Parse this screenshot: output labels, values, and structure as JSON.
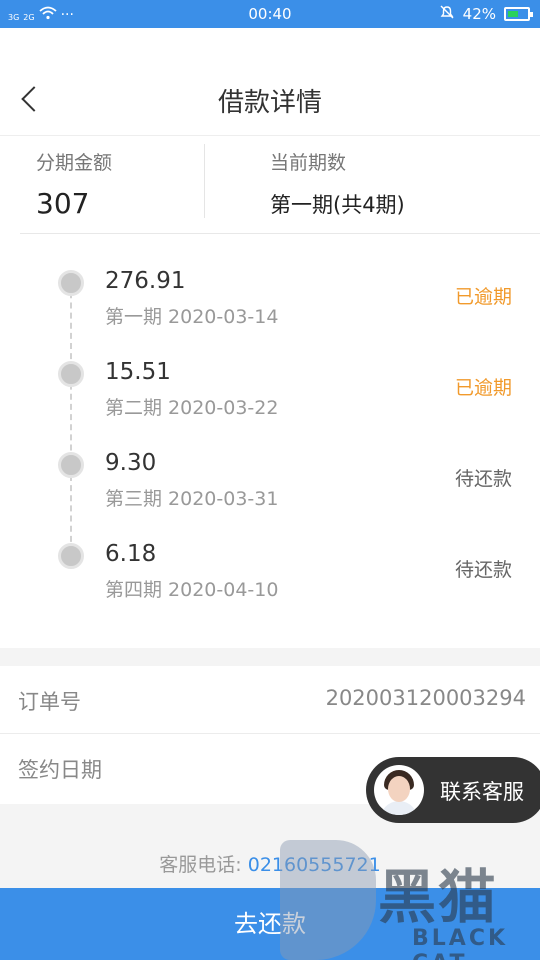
{
  "status_bar": {
    "network_1": "3G",
    "network_2": "2G",
    "more": "···",
    "time": "00:40",
    "battery": "42%"
  },
  "header": {
    "title": "借款详情"
  },
  "summary": {
    "amount_label": "分期金额",
    "amount_value": "307",
    "period_label": "当前期数",
    "period_value": "第一期(共4期)"
  },
  "installments": [
    {
      "amount": "276.91",
      "date": "第一期 2020-03-14",
      "status": "已逾期"
    },
    {
      "amount": "15.51",
      "date": "第二期 2020-03-22",
      "status": "已逾期"
    },
    {
      "amount": "9.30",
      "date": "第三期 2020-03-31",
      "status": "待还款"
    },
    {
      "amount": "6.18",
      "date": "第四期 2020-04-10",
      "status": "待还款"
    }
  ],
  "order": {
    "order_label": "订单号",
    "order_value": "202003120003294",
    "sign_label": "签约日期"
  },
  "service": {
    "phone_label": "客服电话:",
    "phone_number": "02160555721",
    "contact_label": "联系客服"
  },
  "cta": {
    "label": "去还款"
  },
  "watermark": {
    "cn": "黑猫",
    "en": "BLACK CAT"
  },
  "colors": {
    "primary": "#3b8fe8",
    "overdue": "#f19a2c",
    "pending": "#666666"
  }
}
